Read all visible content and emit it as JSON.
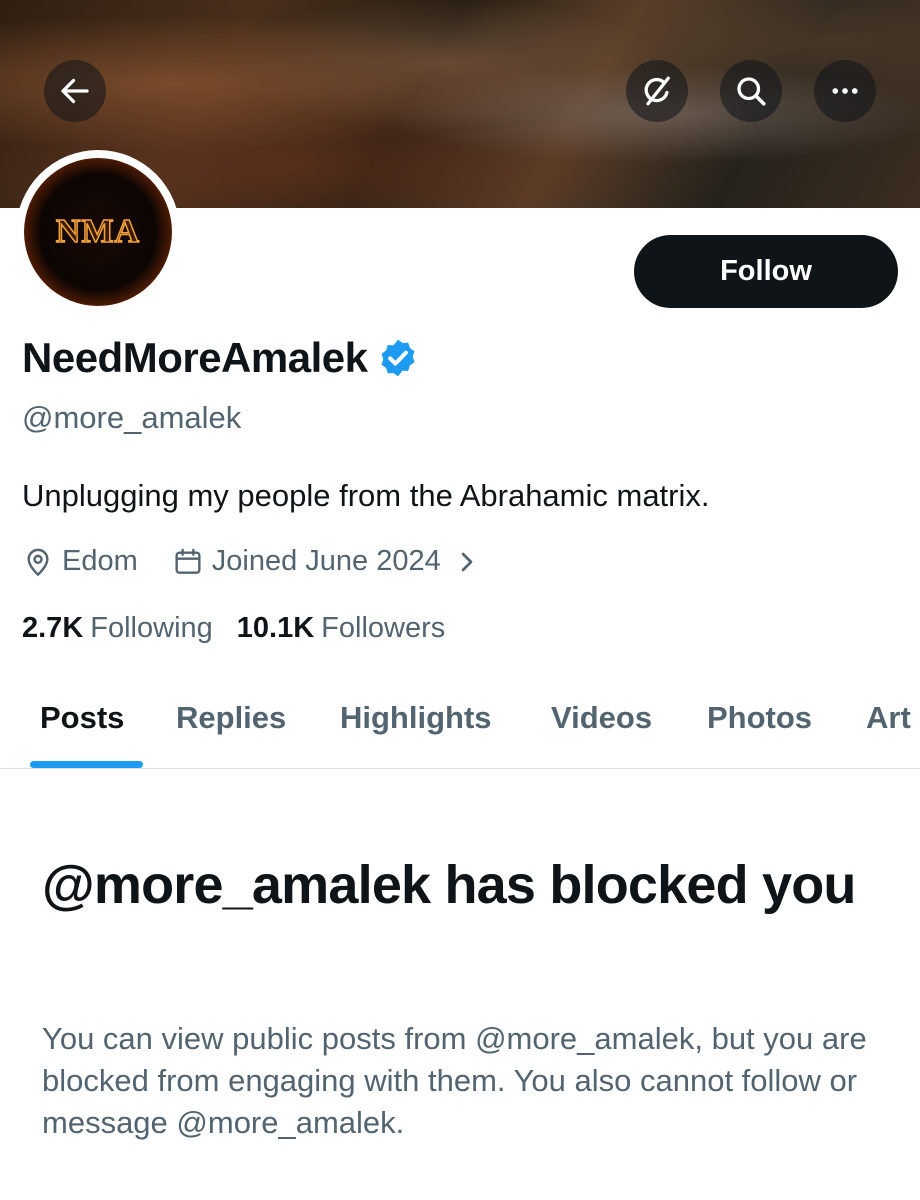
{
  "header": {
    "back_icon": "arrow-left-icon",
    "grok_icon": "grok-icon",
    "search_icon": "search-icon",
    "more_icon": "more-icon"
  },
  "profile": {
    "avatar_text": "NMA",
    "display_name": "NeedMoreAmalek",
    "verified": true,
    "handle": "@more_amalek",
    "bio": "Unplugging my people from the Abrahamic matrix.",
    "location": "Edom",
    "joined": "Joined June 2024",
    "following_count": "2.7K",
    "following_label": "Following",
    "followers_count": "10.1K",
    "followers_label": "Followers",
    "follow_label": "Follow"
  },
  "tabs": [
    {
      "label": "Posts",
      "active": true
    },
    {
      "label": "Replies"
    },
    {
      "label": "Highlights"
    },
    {
      "label": "Videos"
    },
    {
      "label": "Photos"
    },
    {
      "label": "Art"
    }
  ],
  "blocked": {
    "title": "@more_amalek has blocked you",
    "description": "You can view public posts from @more_amalek, but you are blocked from engaging with them. You also cannot follow or message @more_amalek."
  },
  "colors": {
    "accent": "#1d9bf0",
    "text_primary": "#0f1419",
    "text_secondary": "#536471",
    "button_bg": "#0f1419"
  }
}
